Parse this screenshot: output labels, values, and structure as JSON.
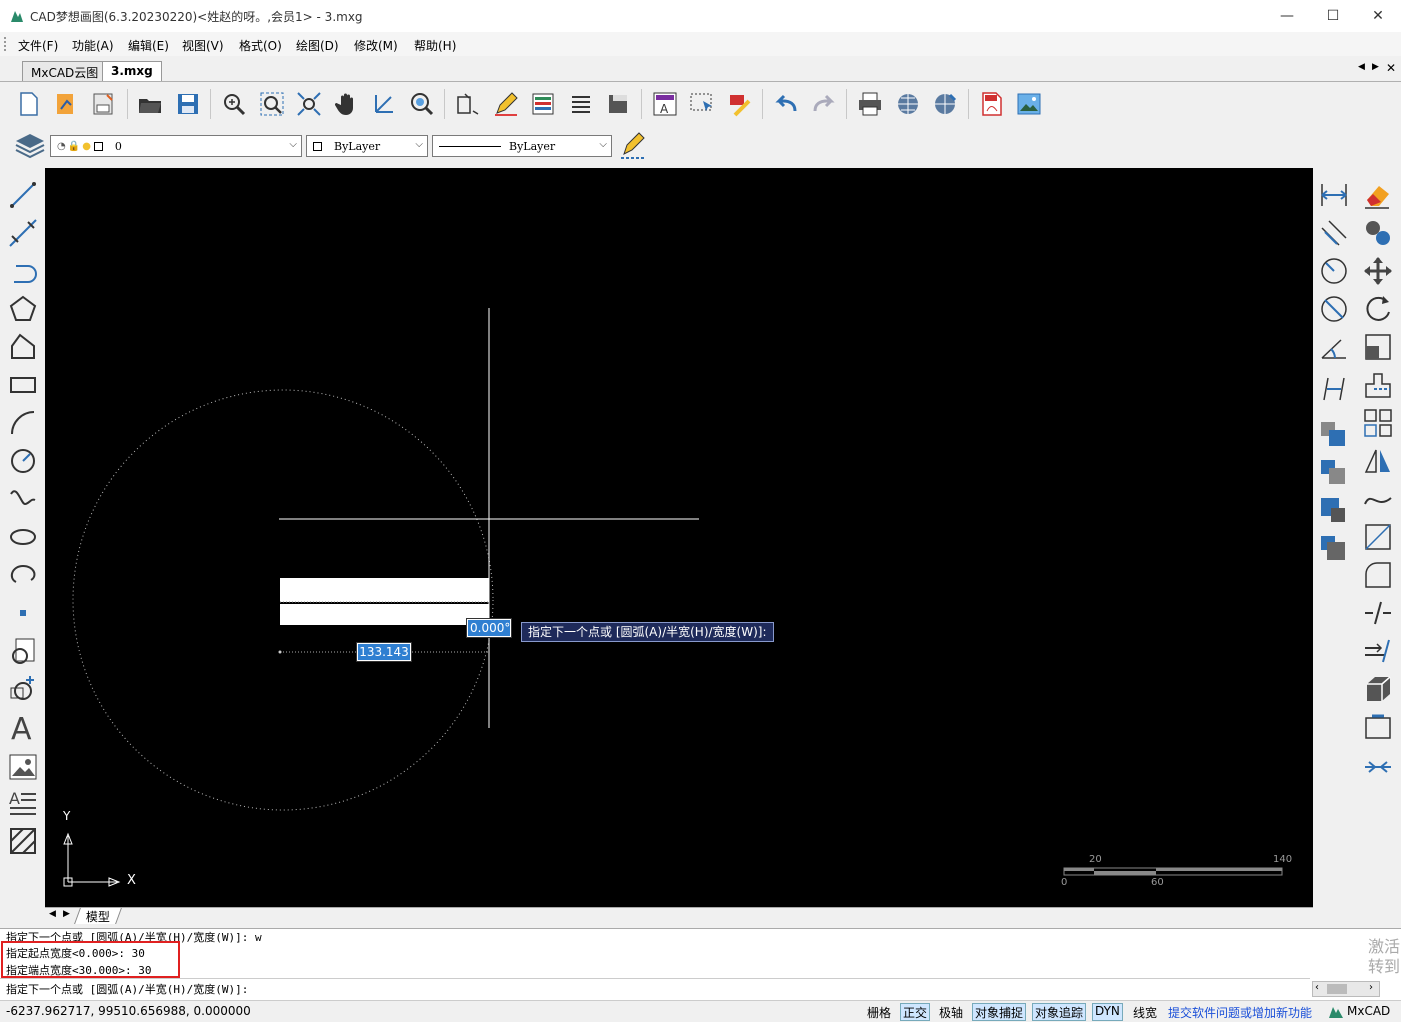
{
  "titlebar": {
    "title": "CAD梦想画图(6.3.20230220)<姓赵的呀。,会员1> - 3.mxg",
    "minimize": "—",
    "maximize": "☐",
    "close": "✕"
  },
  "menu": {
    "items": [
      "文件(F)",
      "功能(A)",
      "编辑(E)",
      "视图(V)",
      "格式(O)",
      "绘图(D)",
      "修改(M)",
      "帮助(H)"
    ]
  },
  "tabs": {
    "items": [
      "MxCAD云图",
      "3.mxg"
    ],
    "nav_prev": "◀",
    "nav_next": "▶",
    "close": "✕"
  },
  "layer_bar": {
    "layer_value": "0",
    "color_value": "ByLayer",
    "linetype_value": "ByLayer"
  },
  "canvas": {
    "dyn_angle": "0.000°",
    "dyn_length": "133.143",
    "prompt_tooltip": "指定下一个点或 [圆弧(A)/半宽(H)/宽度(W)]:",
    "axis_y": "Y",
    "axis_x": "X",
    "scale_labels": {
      "top_left": "20",
      "top_right": "140",
      "bottom_left": "0",
      "bottom_mid": "60"
    }
  },
  "layout_tabs": {
    "model": "模型"
  },
  "command": {
    "lines": [
      "指定下一个点或 [圆弧(A)/半宽(H)/宽度(W)]: w",
      "指定起点宽度<0.000>: 30",
      "指定端点宽度<30.000>: 30"
    ],
    "input_line": "指定下一个点或 [圆弧(A)/半宽(H)/宽度(W)]:",
    "watermark": "激活\n转到"
  },
  "statusbar": {
    "coords": "-6237.962717,  99510.656988,  0.000000",
    "buttons": [
      {
        "label": "栅格",
        "on": false
      },
      {
        "label": "正交",
        "on": true
      },
      {
        "label": "极轴",
        "on": false
      },
      {
        "label": "对象捕捉",
        "on": true
      },
      {
        "label": "对象追踪",
        "on": true
      },
      {
        "label": "DYN",
        "on": true
      },
      {
        "label": "线宽",
        "on": false
      }
    ],
    "feedback_link": "提交软件问题或增加新功能",
    "brand": "MxCAD"
  },
  "colors": {
    "canvas_bg": "#000000",
    "accent_blue": "#2f7fd1",
    "highlight_red": "#e02020",
    "link_blue": "#1a4fd8"
  }
}
